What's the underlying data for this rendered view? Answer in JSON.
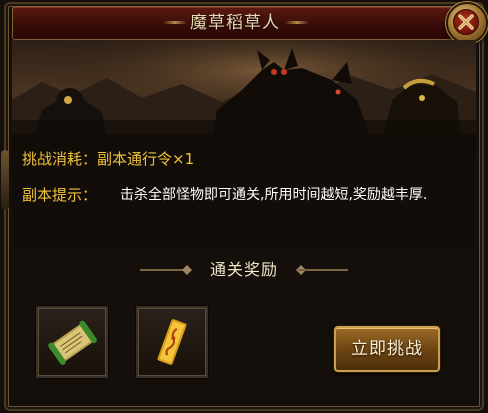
{
  "window": {
    "title": "魔草稻草人"
  },
  "info": {
    "cost_label": "挑战消耗：",
    "cost_value": "副本通行令×1",
    "hint_label": "副本提示：",
    "hint_value": "击杀全部怪物即可通关,所用时间越短,奖励越丰厚."
  },
  "rewards": {
    "header": "通关奖励",
    "items": [
      {
        "icon": "green-scroll-icon"
      },
      {
        "icon": "golden-talisman-icon"
      }
    ]
  },
  "actions": {
    "challenge_label": "立即挑战"
  },
  "colors": {
    "label_gold": "#f0c43a",
    "value_white": "#ffffff",
    "title_bar": "#3a0c08",
    "button_gold": "#c9a04d"
  }
}
